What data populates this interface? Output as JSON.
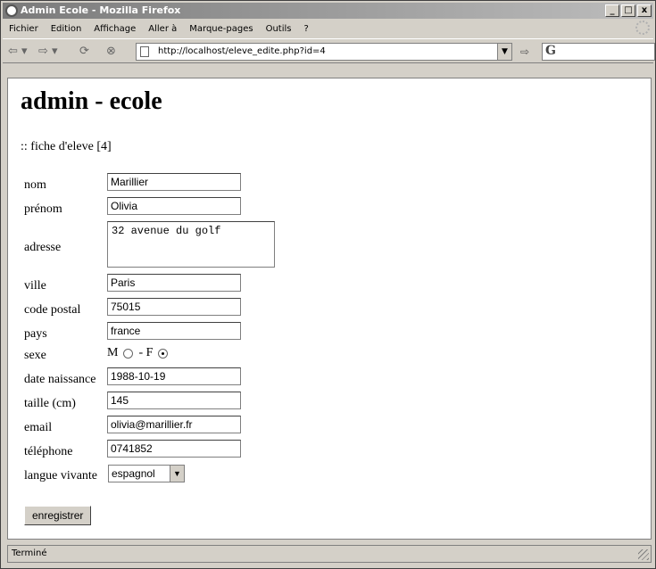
{
  "window": {
    "title": "Admin Ecole - Mozilla Firefox",
    "controls": [
      "_",
      "□",
      "x"
    ]
  },
  "menubar": {
    "items": [
      "Fichier",
      "Edition",
      "Affichage",
      "Aller à",
      "Marque-pages",
      "Outils",
      "?"
    ]
  },
  "navbar": {
    "back_icon": "back-arrow-icon",
    "forward_icon": "forward-arrow-icon",
    "reload_icon": "reload-icon",
    "stop_icon": "stop-icon",
    "url": "http://localhost/eleve_edite.php?id=4",
    "search_engine_glyph": "G"
  },
  "page": {
    "heading": "admin - ecole",
    "subheading": ":: fiche d'eleve [4]"
  },
  "form": {
    "labels": {
      "nom": "nom",
      "prenom": "prénom",
      "adresse": "adresse",
      "ville": "ville",
      "code_postal": "code postal",
      "pays": "pays",
      "sexe": "sexe",
      "date_naissance": "date naissance",
      "taille": "taille (cm)",
      "email": "email",
      "telephone": "téléphone",
      "langue": "langue vivante"
    },
    "values": {
      "nom": "Marillier",
      "prenom": "Olivia",
      "adresse": "32 avenue du golf",
      "ville": "Paris",
      "code_postal": "75015",
      "pays": "france",
      "date_naissance": "1988-10-19",
      "taille": "145",
      "email": "olivia@marillier.fr",
      "telephone": "0741852",
      "langue": "espagnol"
    },
    "sexe_options": {
      "m": "M",
      "separator": "- F",
      "selected": "F"
    },
    "submit_label": "enregistrer"
  },
  "status": {
    "text": "Terminé"
  }
}
